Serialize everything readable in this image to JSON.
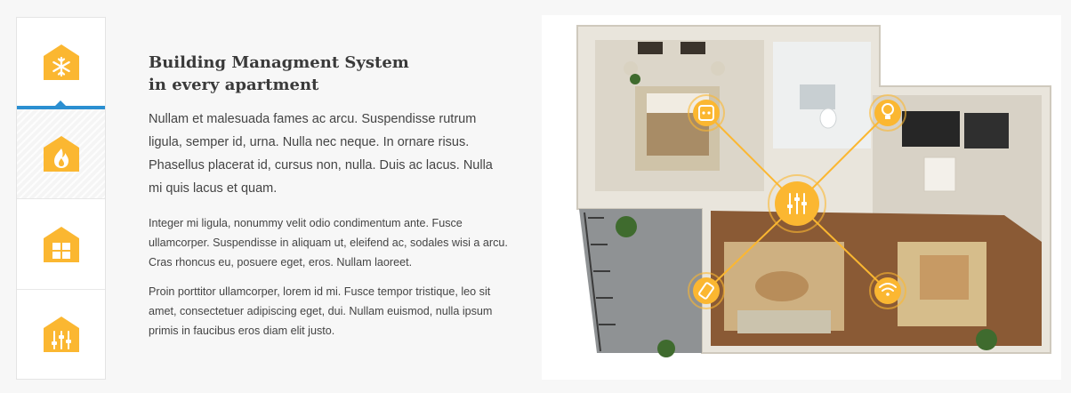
{
  "tabs": [
    {
      "icon": "snowflake-icon",
      "active": true
    },
    {
      "icon": "flame-icon",
      "active": false
    },
    {
      "icon": "window-icon",
      "active": false
    },
    {
      "icon": "sliders-icon",
      "active": false
    }
  ],
  "content": {
    "title_line1": "Building Managment System",
    "title_line2": "in every apartment",
    "lead": "Nullam et malesuada fames ac arcu. Suspendisse rutrum ligula, semper id, urna. Nulla nec neque. In ornare risus. Phasellus placerat id, cursus non, nulla. Duis ac lacus. Nulla mi quis lacus et quam.",
    "paragraph2": "Integer mi ligula, nonummy velit odio condimentum ante. Fusce ullamcorper. Suspendisse in aliquam ut, eleifend ac, sodales wisi a arcu. Cras rhoncus eu, posuere eget, eros. Nullam laoreet.",
    "paragraph3": "Proin porttitor ullamcorper, lorem id mi. Fusce tempor tristique, leo sit amet, consectetuer adipiscing eget, dui. Nullam euismod, nulla ipsum primis in faucibus eros diam elit justo."
  },
  "floor_plan": {
    "hub_icon": "sliders-icon",
    "device_icons": [
      "socket-icon",
      "lightbulb-icon",
      "remote-icon",
      "wifi-icon"
    ]
  },
  "colors": {
    "accent_yellow": "#fbb731",
    "active_tab_blue": "#2b8fd1",
    "heading": "#3a3a3a",
    "body_text": "#444444"
  }
}
